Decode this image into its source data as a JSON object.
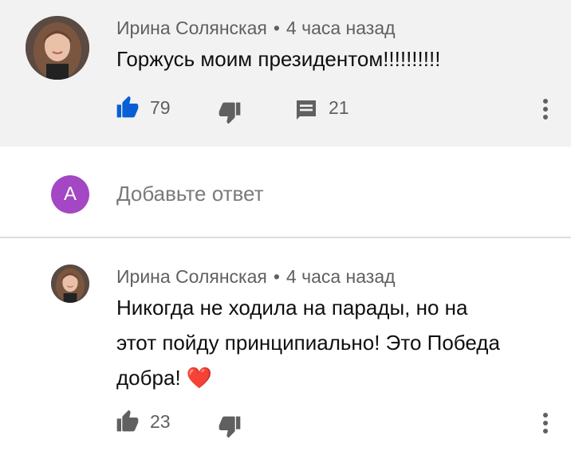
{
  "comments": [
    {
      "author": "Ирина Солянская",
      "separator": "•",
      "time": "4 часа назад",
      "text": "Горжусь моим президентом!!!!!!!!!!",
      "likes": "79",
      "replies_count": "21",
      "like_active": true,
      "accent_color": "#065fd4"
    },
    {
      "author": "Ирина Солянская",
      "separator": "•",
      "time": "4 часа назад",
      "text_line1": "Никогда не ходила на парады, но на",
      "text_line2": "этот пойду принципиально! Это Победа",
      "text_line3": "добра!",
      "emoji": "❤️",
      "likes": "23",
      "like_active": false
    }
  ],
  "reply_box": {
    "avatar_letter": "A",
    "placeholder": "Добавьте ответ",
    "avatar_color": "#a347c4"
  },
  "icons": {
    "like": "thumbs-up-icon",
    "dislike": "thumbs-down-icon",
    "reply": "comment-icon",
    "menu": "more-vertical-icon"
  }
}
